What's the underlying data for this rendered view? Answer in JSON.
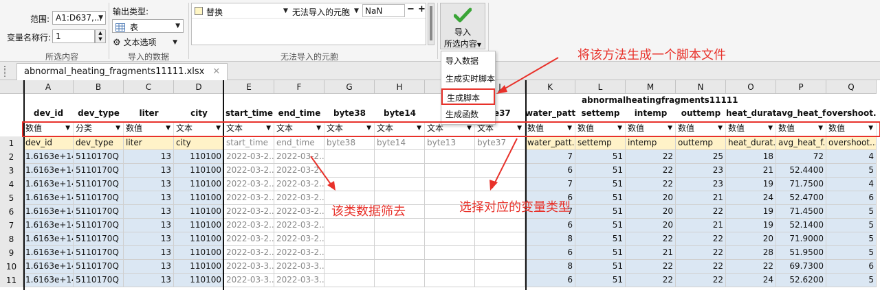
{
  "toolstrip": {
    "range_label": "范围:",
    "range_value": "A1:D637,...",
    "varnames_row_label": "变量名称行:",
    "varnames_row_value": "1",
    "selection_caption": "所选内容",
    "output_type_label": "输出类型:",
    "output_type_value": "表",
    "text_options_label": "文本选项",
    "imported_data_caption": "导入的数据",
    "rule_action": "替换",
    "rule_condition": "无法导入的元胞",
    "rule_value": "NaN",
    "unimportable_caption": "无法导入的元胞",
    "import_label": "导入",
    "import_sub_label": "所选内容"
  },
  "import_menu": {
    "items": [
      "导入数据",
      "生成实时脚本",
      "生成脚本",
      "生成函数"
    ]
  },
  "file_tab": {
    "label": "abnormal_heating_fragments11111.xlsx",
    "close": "✕"
  },
  "sheet": {
    "table_name": "abnormalheatingfragments11111",
    "columns": [
      {
        "letter": "A",
        "name": "dev_id",
        "type": "数值"
      },
      {
        "letter": "B",
        "name": "dev_type",
        "type": "分类"
      },
      {
        "letter": "C",
        "name": "liter",
        "type": "数值"
      },
      {
        "letter": "D",
        "name": "city",
        "type": "文本"
      },
      {
        "letter": "E",
        "name": "start_time",
        "type": "文本"
      },
      {
        "letter": "F",
        "name": "end_time",
        "type": "文本"
      },
      {
        "letter": "G",
        "name": "byte38",
        "type": "文本"
      },
      {
        "letter": "H",
        "name": "byte14",
        "type": "文本"
      },
      {
        "letter": "I",
        "name": "b",
        "type": "文本"
      },
      {
        "letter": "J",
        "name": "te37",
        "type": "文本"
      },
      {
        "letter": "K",
        "name": "water_patt...",
        "type": "数值"
      },
      {
        "letter": "L",
        "name": "settemp",
        "type": "数值"
      },
      {
        "letter": "M",
        "name": "intemp",
        "type": "数值"
      },
      {
        "letter": "N",
        "name": "outtemp",
        "type": "数值"
      },
      {
        "letter": "O",
        "name": "heat_durat...",
        "type": "数值"
      },
      {
        "letter": "P",
        "name": "avg_heat_f...",
        "type": "数值"
      },
      {
        "letter": "Q",
        "name": "overshoot...",
        "type": "数值"
      }
    ],
    "header_row": [
      "dev_id",
      "dev_type",
      "liter",
      "city",
      "start_time",
      "end_time",
      "byte38",
      "byte14",
      "byte13",
      "byte37",
      "water_patt...",
      "settemp",
      "intemp",
      "outtemp",
      "heat_durat...",
      "avg_heat_f...",
      "overshoot..."
    ],
    "rows": [
      {
        "n": "2",
        "cells": [
          "1.6163e+14",
          "5110170Q",
          "13",
          "110100",
          "2022-03-2...",
          "2022-03-2...",
          "",
          "",
          "",
          "",
          "7",
          "51",
          "22",
          "25",
          "18",
          "72",
          "4"
        ]
      },
      {
        "n": "3",
        "cells": [
          "1.6163e+14",
          "5110170Q",
          "13",
          "110100",
          "2022-03-2...",
          "2022-03-2...",
          "",
          "",
          "",
          "",
          "6",
          "51",
          "22",
          "23",
          "21",
          "52.4400",
          "5"
        ]
      },
      {
        "n": "4",
        "cells": [
          "1.6163e+14",
          "5110170Q",
          "13",
          "110100",
          "2022-03-2...",
          "2022-03-2...",
          "",
          "",
          "",
          "",
          "7",
          "51",
          "22",
          "23",
          "19",
          "71.7500",
          "4"
        ]
      },
      {
        "n": "5",
        "cells": [
          "1.6163e+14",
          "5110170Q",
          "13",
          "110100",
          "2022-03-2...",
          "2022-03-2...",
          "",
          "",
          "",
          "",
          "6",
          "51",
          "20",
          "21",
          "24",
          "52.4700",
          "6"
        ]
      },
      {
        "n": "6",
        "cells": [
          "1.6163e+14",
          "5110170Q",
          "13",
          "110100",
          "2022-03-2...",
          "2022-03-2...",
          "",
          "",
          "",
          "",
          "7",
          "51",
          "20",
          "22",
          "19",
          "71.4500",
          "5"
        ]
      },
      {
        "n": "7",
        "cells": [
          "1.6163e+14",
          "5110170Q",
          "13",
          "110100",
          "2022-03-2...",
          "2022-03-2...",
          "",
          "",
          "",
          "",
          "6",
          "51",
          "20",
          "21",
          "19",
          "52.1400",
          "5"
        ]
      },
      {
        "n": "8",
        "cells": [
          "1.6163e+14",
          "5110170Q",
          "13",
          "110100",
          "2022-03-2...",
          "2022-03-2...",
          "",
          "",
          "",
          "",
          "8",
          "51",
          "22",
          "22",
          "20",
          "71.9000",
          "5"
        ]
      },
      {
        "n": "9",
        "cells": [
          "1.6163e+14",
          "5110170Q",
          "13",
          "110100",
          "2022-03-2...",
          "2022-03-2...",
          "",
          "",
          "",
          "",
          "6",
          "51",
          "21",
          "22",
          "28",
          "51.9500",
          "5"
        ]
      },
      {
        "n": "10",
        "cells": [
          "1.6163e+14",
          "5110170Q",
          "13",
          "110100",
          "2022-03-3...",
          "2022-03-3...",
          "",
          "",
          "",
          "",
          "8",
          "51",
          "22",
          "22",
          "22",
          "69.7300",
          "6"
        ]
      },
      {
        "n": "11",
        "cells": [
          "1.6163e+14",
          "5110170Q",
          "13",
          "110100",
          "2022-03-3...",
          "2022-03-3...",
          "",
          "",
          "",
          "",
          "6",
          "51",
          "22",
          "22",
          "24",
          "52.6200",
          "5"
        ]
      }
    ]
  },
  "annotations": {
    "script": "将该方法生成一个脚本文件",
    "filter": "该类数据筛去",
    "type": "选择对应的变量类型"
  },
  "colors": {
    "annotation": "#e8312a",
    "selected_cell": "#dbe7f3",
    "header_cell": "#fff2c8",
    "check": "#3aa537"
  }
}
